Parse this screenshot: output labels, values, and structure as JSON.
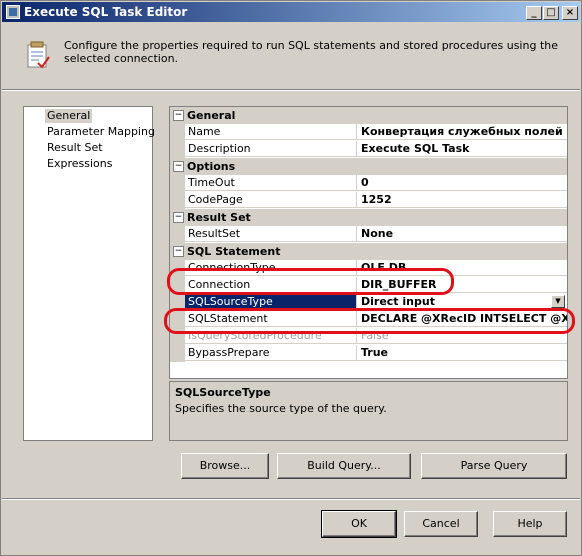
{
  "window": {
    "title": "Execute SQL Task Editor",
    "minimize_glyph": "_",
    "maximize_glyph": "□",
    "close_glyph": "×"
  },
  "header": {
    "description": "Configure the properties required to run SQL statements and stored procedures using the selected connection.",
    "icon": "task-editor-icon"
  },
  "nav": {
    "items": [
      {
        "label": "General",
        "selected": true
      },
      {
        "label": "Parameter Mapping",
        "selected": false
      },
      {
        "label": "Result Set",
        "selected": false
      },
      {
        "label": "Expressions",
        "selected": false
      }
    ]
  },
  "grid": {
    "categories": {
      "general": "General",
      "options": "Options",
      "result_set": "Result Set",
      "sql_statement": "SQL Statement"
    },
    "toggle_glyph": "−",
    "rows": {
      "name": {
        "name": "Name",
        "value": "Конвертация служебных полей"
      },
      "description": {
        "name": "Description",
        "value": "Execute SQL Task"
      },
      "timeout": {
        "name": "TimeOut",
        "value": "0"
      },
      "codepage": {
        "name": "CodePage",
        "value": "1252"
      },
      "resultset": {
        "name": "ResultSet",
        "value": "None"
      },
      "connectiontype": {
        "name": "ConnectionType",
        "value": "OLE DB"
      },
      "connection": {
        "name": "Connection",
        "value": "DIR_BUFFER"
      },
      "sqlsourcetype": {
        "name": "SQLSourceType",
        "value": "Direct input"
      },
      "sqlstatement": {
        "name": "SQLStatement",
        "value": "DECLARE @XRecID INTSELECT @XRecID"
      },
      "isquerystoredprocedure": {
        "name": "IsQueryStoredProcedure",
        "value": "False"
      },
      "bypassprepare": {
        "name": "BypassPrepare",
        "value": "True"
      }
    },
    "dropdown_glyph": "▼"
  },
  "description_panel": {
    "title": "SQLSourceType",
    "text": "Specifies the source type of the query."
  },
  "buttons": {
    "browse": "Browse...",
    "build_query": "Build Query...",
    "parse_query": "Parse Query",
    "ok": "OK",
    "cancel": "Cancel",
    "help": "Help"
  },
  "colors": {
    "highlight_annotation": "#e0101b",
    "selection": "#0a246a",
    "title_gradient_start": "#0a246a"
  }
}
